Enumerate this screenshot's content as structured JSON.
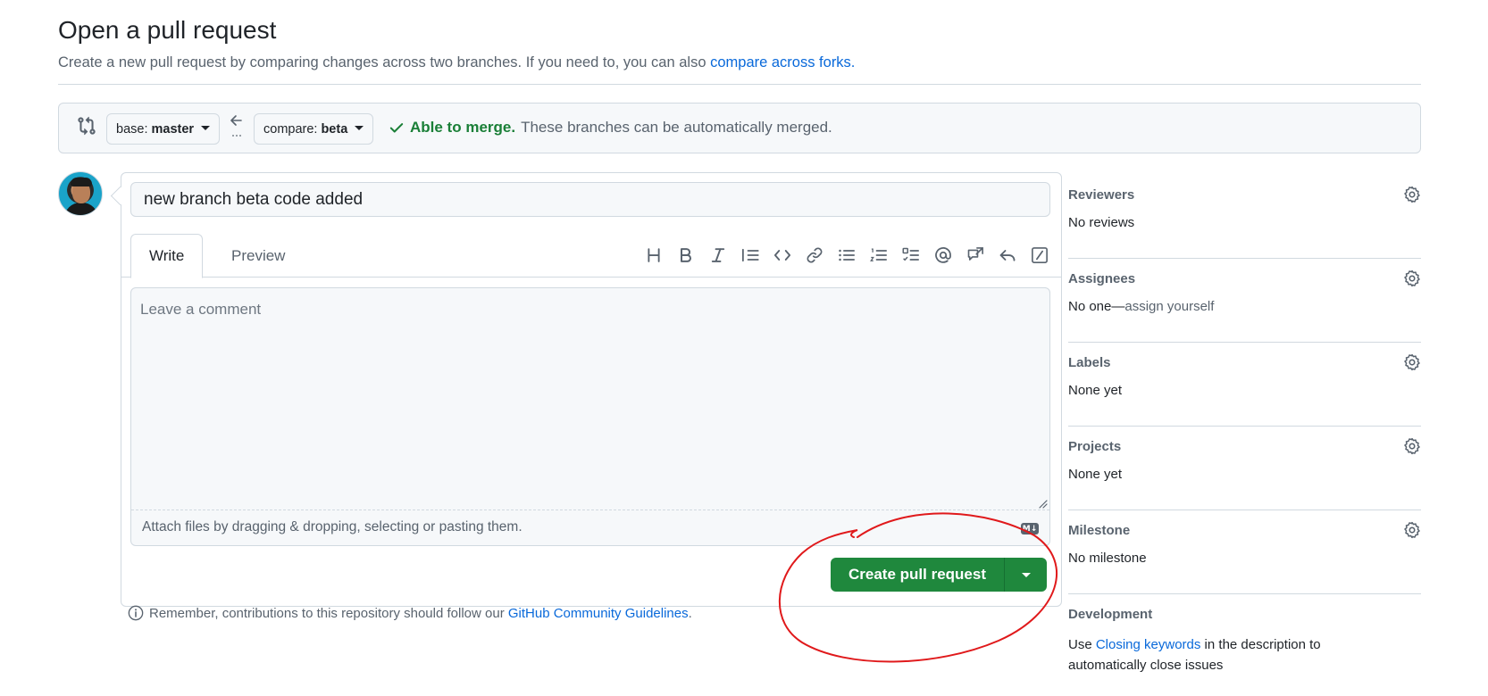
{
  "header": {
    "title": "Open a pull request",
    "subtitle_prefix": "Create a new pull request by comparing changes across two branches. If you need to, you can also ",
    "subtitle_link": "compare across forks."
  },
  "compare": {
    "base_label": "base:",
    "base_branch": "master",
    "compare_label": "compare:",
    "compare_branch": "beta",
    "status_ok": "Able to merge.",
    "status_desc": "These branches can be automatically merged."
  },
  "form": {
    "title_value": "new branch beta code added",
    "tabs": [
      "Write",
      "Preview"
    ],
    "comment_placeholder": "Leave a comment",
    "attach_hint": "Attach files by dragging & dropping, selecting or pasting them.",
    "markdown_badge": "M↓",
    "submit_label": "Create pull request"
  },
  "guidelines": {
    "prefix": "Remember, contributions to this repository should follow our ",
    "link": "GitHub Community Guidelines",
    "suffix": "."
  },
  "sidebar": {
    "reviewers": {
      "heading": "Reviewers",
      "value": "No reviews"
    },
    "assignees": {
      "heading": "Assignees",
      "value": "No one—",
      "link": "assign yourself"
    },
    "labels": {
      "heading": "Labels",
      "value": "None yet"
    },
    "projects": {
      "heading": "Projects",
      "value": "None yet"
    },
    "milestone": {
      "heading": "Milestone",
      "value": "No milestone"
    },
    "development": {
      "heading": "Development",
      "prefix": "Use ",
      "link": "Closing keywords",
      "suffix": " in the description to automatically close issues"
    }
  },
  "colors": {
    "accent_link": "#0969da",
    "success": "#1a7f37",
    "primary_button": "#1f883d",
    "annotation": "#e0191b"
  }
}
